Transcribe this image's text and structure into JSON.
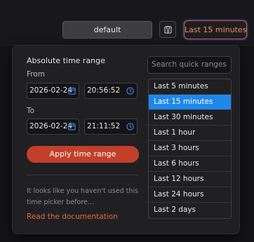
{
  "toolbar": {
    "profile_value": "default",
    "time_range_label": "Last 15 minutes",
    "save_icon": "save-icon"
  },
  "picker": {
    "title": "Absolute time range",
    "from_label": "From",
    "to_label": "To",
    "from_date": "2026-02-24",
    "from_time": "20:56:52",
    "to_date": "2026-02-24",
    "to_time": "21:11:52",
    "apply_label": "Apply time range",
    "hint_line1": "It looks like you haven't used this",
    "hint_line2": "time picker before...",
    "doc_link": "Read the documentation",
    "search_placeholder": "Search quick ranges",
    "quick_ranges": [
      "Last 5 minutes",
      "Last 15 minutes",
      "Last 30 minutes",
      "Last 1 hour",
      "Last 3 hours",
      "Last 6 hours",
      "Last 12 hours",
      "Last 24 hours",
      "Last 2 days"
    ],
    "selected_range": "Last 15 minutes"
  },
  "colors": {
    "accent": "#e05a30",
    "apply_button": "#c2402a",
    "selected": "#1f87ea",
    "link": "#e06a3a"
  }
}
